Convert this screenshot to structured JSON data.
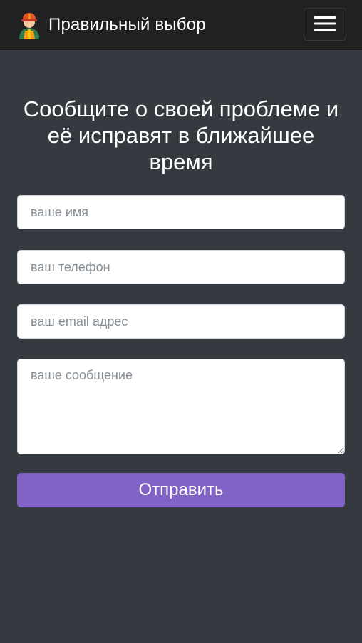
{
  "navbar": {
    "brand_name": "Правильный выбор",
    "brand_icon": "worker-avatar-icon",
    "menu_icon": "hamburger-menu-icon"
  },
  "form": {
    "heading": "Сообщите о своей проблеме и её исправят в ближайшее время",
    "name_placeholder": "ваше имя",
    "phone_placeholder": "ваш телефон",
    "email_placeholder": "ваш email адрес",
    "message_placeholder": "ваше сообщение",
    "submit_label": "Отправить"
  },
  "colors": {
    "page_background": "#343a40",
    "navbar_background": "#212121",
    "accent": "#8163c7"
  }
}
